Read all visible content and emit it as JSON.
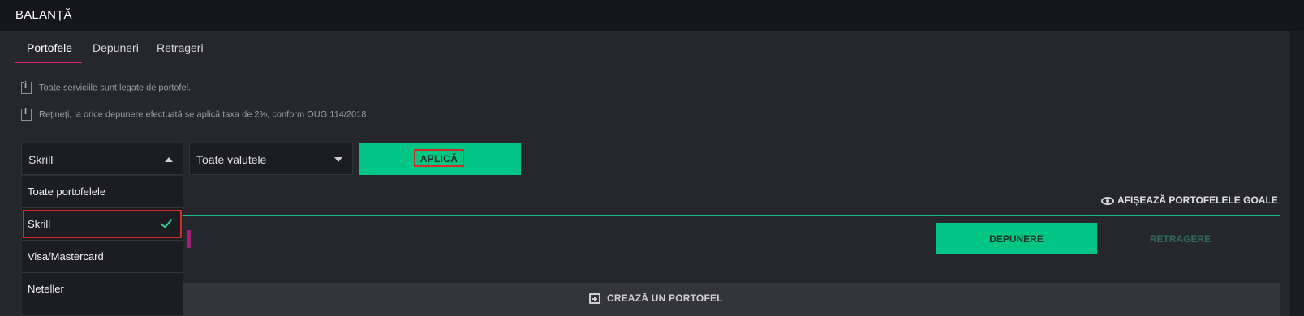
{
  "header": {
    "title": "BALANȚĂ"
  },
  "tabs": [
    {
      "label": "Portofele",
      "active": true
    },
    {
      "label": "Depuneri",
      "active": false
    },
    {
      "label": "Retrageri",
      "active": false
    }
  ],
  "notes": [
    "Toate serviciile sunt legate de portofel.",
    "Rețineți, la orice depunere efectuată se aplică taxa de 2%, conform OUG 114/2018"
  ],
  "filters": {
    "wallet_select": {
      "value": "Skrill",
      "open": true
    },
    "currency_select": {
      "value": "Toate valutele"
    },
    "apply_label": "APLICĂ"
  },
  "dropdown": {
    "options": [
      "Toate portofelele",
      "Skrill",
      "Visa/Mastercard",
      "Neteller"
    ],
    "selected": "Skrill"
  },
  "show_empty_label": "AFIȘEAZĂ PORTOFELELE GOALE",
  "wallet_card": {
    "deposit_label": "DEPUNERE",
    "withdraw_label": "RETRAGERE"
  },
  "create_wallet_label": "CREAZĂ UN PORTOFEL",
  "colors": {
    "accent_green": "#00c585",
    "tab_underline": "#e0247a",
    "highlight_frame": "#d62b2b",
    "wallet_accent": "#a51e76"
  }
}
